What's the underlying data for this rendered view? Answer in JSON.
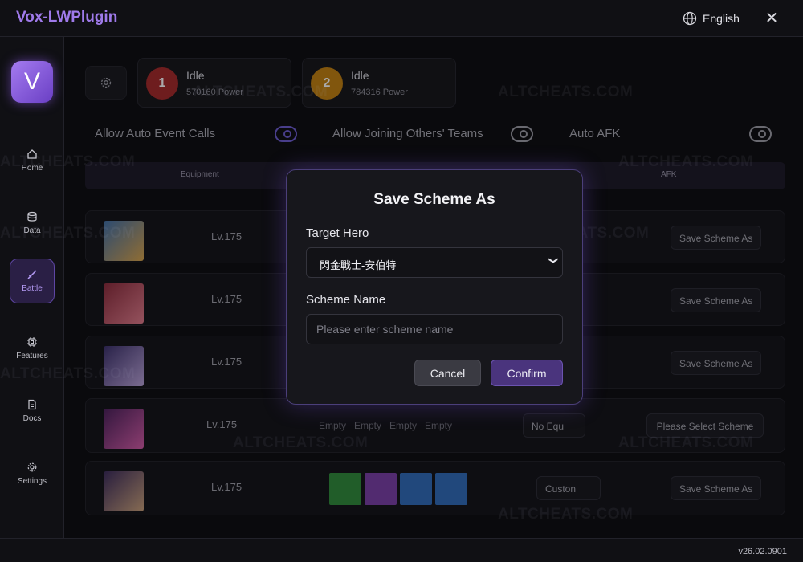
{
  "app": {
    "title": "Vox-LWPlugin",
    "language": "English",
    "version": "v26.02.0901",
    "logo_letter": "V"
  },
  "sidebar": {
    "items": [
      {
        "label": "Home",
        "icon": "home-icon"
      },
      {
        "label": "Data",
        "icon": "database-icon"
      },
      {
        "label": "Battle",
        "icon": "sword-icon",
        "active": true
      },
      {
        "label": "Features",
        "icon": "chip-icon"
      },
      {
        "label": "Docs",
        "icon": "document-icon"
      },
      {
        "label": "Settings",
        "icon": "gear-icon"
      }
    ]
  },
  "accounts": [
    {
      "badge": "1",
      "status": "Idle",
      "power": "570160 Power",
      "color": "#b02a2a"
    },
    {
      "badge": "2",
      "status": "Idle",
      "power": "784316 Power",
      "color": "#c9820c"
    }
  ],
  "toggles": [
    {
      "label": "Allow Auto Event Calls",
      "on": true
    },
    {
      "label": "Allow Joining Others' Teams",
      "on": false
    },
    {
      "label": "Auto AFK",
      "on": false
    }
  ],
  "tabs": [
    "Equipment",
    "AFK"
  ],
  "heroes": [
    {
      "level": "Lv.175",
      "scheme_button": "Save Scheme As"
    },
    {
      "level": "Lv.175",
      "scheme_button": "Save Scheme As"
    },
    {
      "level": "Lv.175",
      "scheme_button": "Save Scheme As"
    },
    {
      "level": "Lv.175",
      "slots": [
        "Empty",
        "Empty",
        "Empty",
        "Empty"
      ],
      "scheme_select": "No Equ",
      "scheme_button": "Please Select Scheme"
    },
    {
      "level": "Lv.175",
      "scheme_select": "Custon",
      "scheme_button": "Save Scheme As"
    }
  ],
  "watermark": "ALTCHEATS.COM",
  "modal": {
    "title": "Save Scheme As",
    "target_hero_label": "Target Hero",
    "target_hero_value": "閃金戰士-安伯特",
    "scheme_name_label": "Scheme Name",
    "scheme_name_placeholder": "Please enter scheme name",
    "cancel": "Cancel",
    "confirm": "Confirm"
  }
}
